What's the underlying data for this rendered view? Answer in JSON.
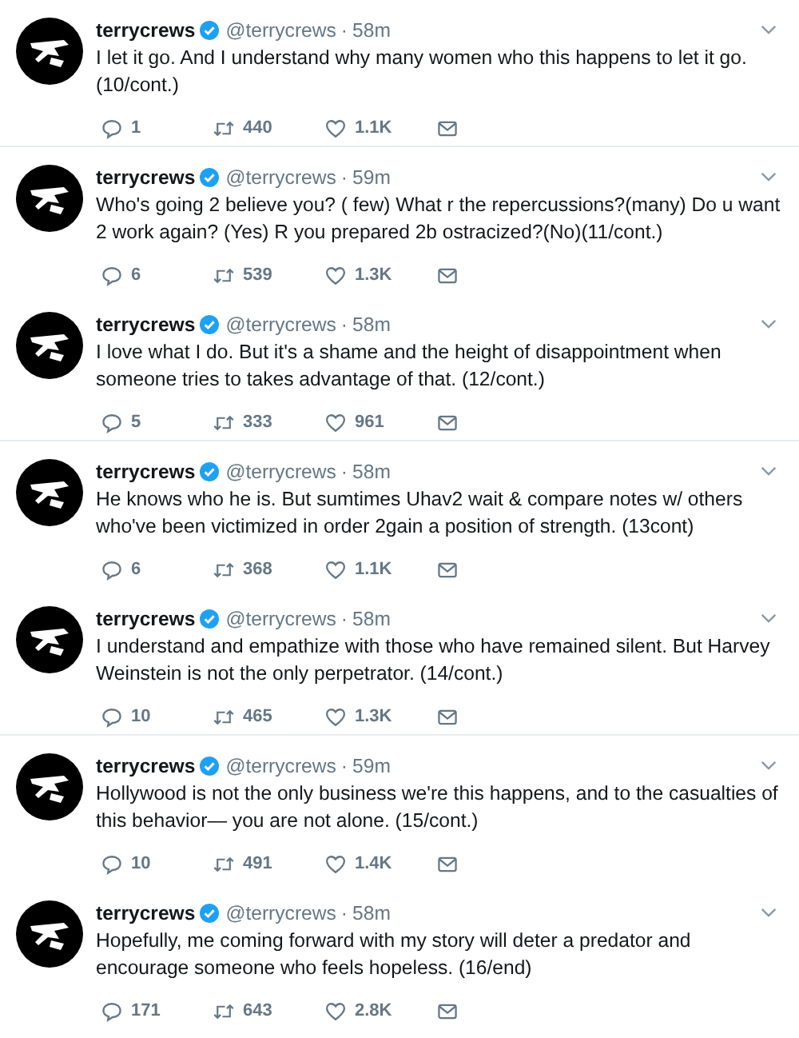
{
  "tweets": [
    {
      "name": "terrycrews",
      "verified": true,
      "handle": "@terrycrews",
      "separator": "·",
      "time": "58m",
      "text": "I let it go. And I understand why many women who this happens to let it go. (10/cont.)",
      "replies": "1",
      "retweets": "440",
      "likes": "1.1K",
      "divider": true
    },
    {
      "name": "terrycrews",
      "verified": true,
      "handle": "@terrycrews",
      "separator": "·",
      "time": "59m",
      "text": "Who's going 2 believe you? ( few) What r the repercussions?(many) Do u want 2 work again? (Yes) R you prepared 2b ostracized?(No)(11/cont.)",
      "replies": "6",
      "retweets": "539",
      "likes": "1.3K",
      "divider": false
    },
    {
      "name": "terrycrews",
      "verified": true,
      "handle": "@terrycrews",
      "separator": "·",
      "time": "58m",
      "text": "I love what I do. But it's a shame and the height of disappointment when someone tries to takes advantage of that. (12/cont.)",
      "replies": "5",
      "retweets": "333",
      "likes": "961",
      "divider": true
    },
    {
      "name": "terrycrews",
      "verified": true,
      "handle": "@terrycrews",
      "separator": "·",
      "time": "58m",
      "text": "He knows who he is. But sumtimes Uhav2 wait & compare notes w/ others who've been victimized in order 2gain a position of strength. (13cont)",
      "replies": "6",
      "retweets": "368",
      "likes": "1.1K",
      "divider": false
    },
    {
      "name": "terrycrews",
      "verified": true,
      "handle": "@terrycrews",
      "separator": "·",
      "time": "58m",
      "text": "I understand and empathize with those who have remained silent. But Harvey Weinstein is not the only perpetrator. (14/cont.)",
      "replies": "10",
      "retweets": "465",
      "likes": "1.3K",
      "divider": true
    },
    {
      "name": "terrycrews",
      "verified": true,
      "handle": "@terrycrews",
      "separator": "·",
      "time": "59m",
      "text": "Hollywood is not the only business we're this happens, and to the casualties of this behavior— you are not alone. (15/cont.)",
      "replies": "10",
      "retweets": "491",
      "likes": "1.4K",
      "divider": false
    },
    {
      "name": "terrycrews",
      "verified": true,
      "handle": "@terrycrews",
      "separator": "·",
      "time": "58m",
      "text": "Hopefully, me coming forward with my story will deter a predator and encourage someone who feels hopeless. (16/end)",
      "replies": "171",
      "retweets": "643",
      "likes": "2.8K",
      "divider": false
    }
  ]
}
